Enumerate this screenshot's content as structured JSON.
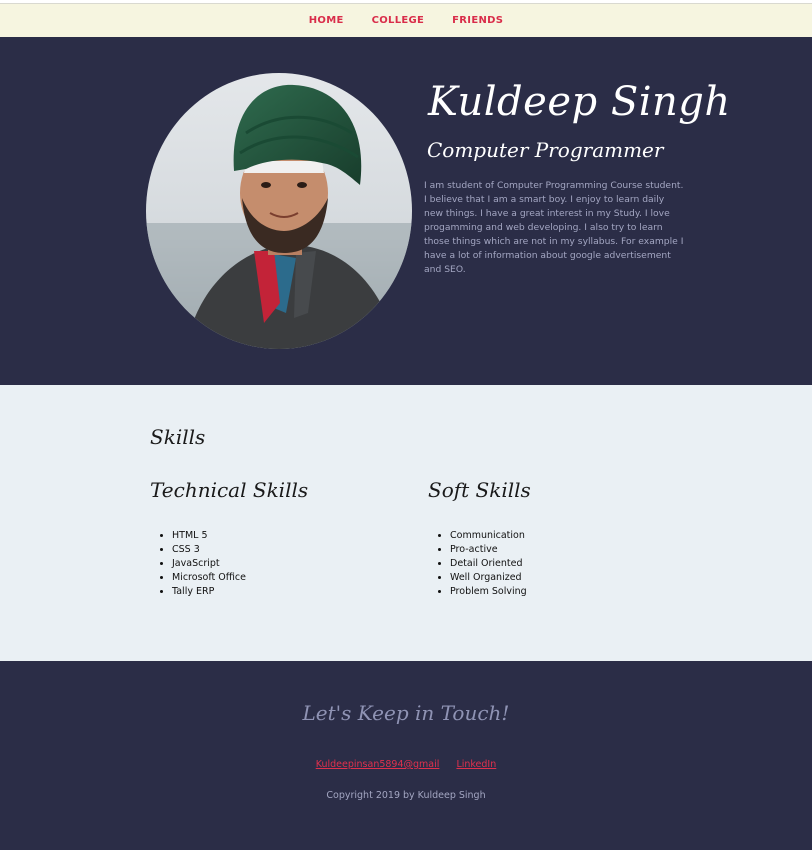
{
  "nav": {
    "items": [
      {
        "label": "HOME"
      },
      {
        "label": "COLLEGE"
      },
      {
        "label": "FRIENDS"
      }
    ]
  },
  "hero": {
    "name": "Kuldeep Singh",
    "role": "Computer Programmer",
    "bio": "I am student of Computer Programming Course student. I believe that I am a smart boy. I enjoy to learn daily new things. I have a great interest in my Study. I love progamming and web developing. I also try to learn those things which are not in my syllabus. For example I have a lot of information about google advertisement and SEO."
  },
  "skills": {
    "title": "Skills",
    "technical": {
      "title": "Technical Skills",
      "items": [
        "HTML 5",
        "CSS 3",
        "JavaScript",
        "Microsoft Office",
        "Tally ERP"
      ]
    },
    "soft": {
      "title": "Soft Skills",
      "items": [
        "Communication",
        "Pro-active",
        "Detail Oriented",
        "Well Organized",
        "Problem Solving"
      ]
    }
  },
  "footer": {
    "title": "Let's Keep in Touch!",
    "email_link": "Kuldeepinsan5894@gmail",
    "linkedin_link": "LinkedIn",
    "copyright": "Copyright 2019 by Kuldeep Singh"
  },
  "colors": {
    "nav_bg": "#f6f5e0",
    "nav_link": "#d92d4a",
    "dark_bg": "#2b2d47",
    "light_bg": "#eaf0f4",
    "muted_text": "#a3a6c2"
  }
}
